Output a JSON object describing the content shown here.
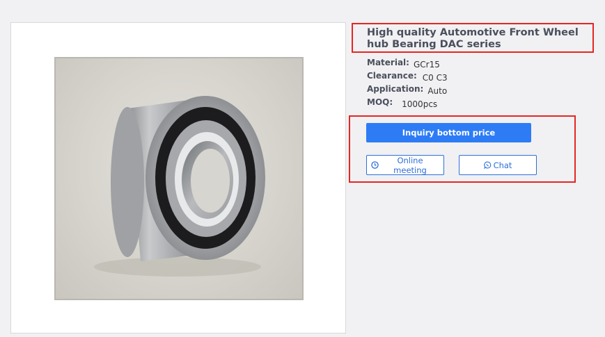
{
  "product": {
    "title": "High quality Automotive Front Wheel hub Bearing DAC series",
    "image_alt": "wheel-hub-bearing-photo"
  },
  "specs": [
    {
      "key": "Material:",
      "value": "GCr15"
    },
    {
      "key": "Clearance:",
      "value": "C0 C3"
    },
    {
      "key": "Application:",
      "value": "Auto"
    },
    {
      "key": "MOQ:",
      "value": "1000pcs"
    }
  ],
  "actions": {
    "inquiry_label": "Inquiry bottom price",
    "meeting_label": "Online meeting",
    "chat_label": "Chat",
    "meeting_icon": "clock-icon",
    "chat_icon": "whatsapp-icon"
  },
  "colors": {
    "primary": "#2d7cf6",
    "highlight_border": "#e52521",
    "title_text": "#4a4f5c"
  }
}
